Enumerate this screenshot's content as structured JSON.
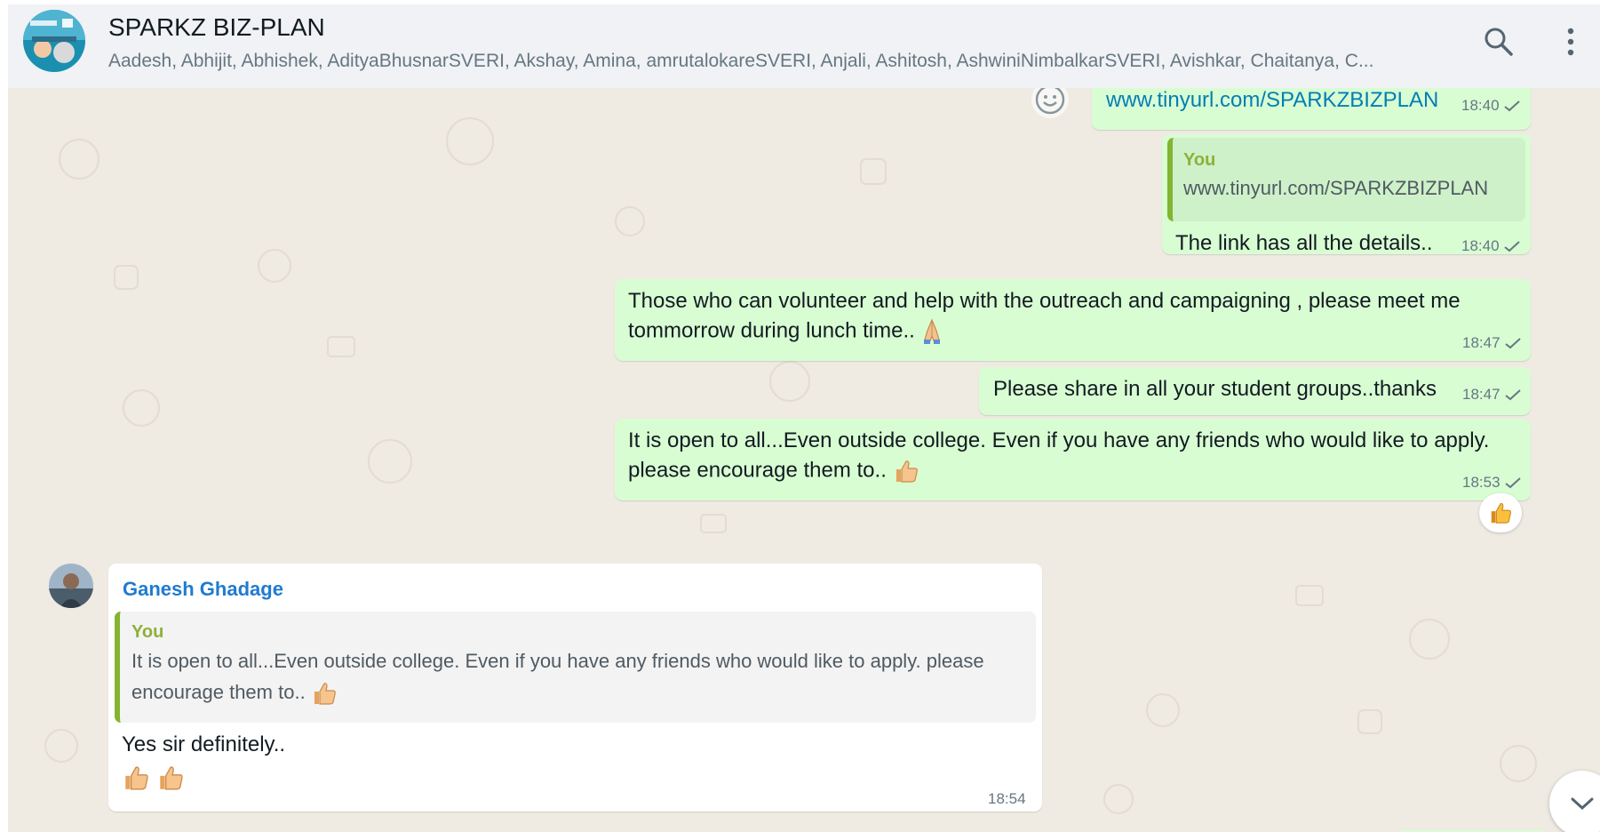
{
  "header": {
    "title": "SPARKZ BIZ-PLAN",
    "members": "Aadesh, Abhijit, Abhishek, AdityaBhusnarSVERI, Akshay, Amina, amrutalokareSVERI, Anjali, Ashitosh, AshwiniNimbalkarSVERI, Avishkar, Chaitanya, C...",
    "icons": [
      "search-icon",
      "more-vertical-icon"
    ]
  },
  "messages": {
    "m1": {
      "text": "www.tinyurl.com/SPARKZBIZPLAN",
      "time": "18:40"
    },
    "m2": {
      "quote_author": "You",
      "quote_text": "www.tinyurl.com/SPARKZBIZPLAN",
      "text": "The link has all the details..",
      "time": "18:40"
    },
    "m3": {
      "line1": "Those who can volunteer and help with the outreach and campaigning , please meet me",
      "line2": "tommorrow during lunch time..",
      "emoji": "folded-hands",
      "time": "18:47"
    },
    "m4": {
      "text": "Please share in all your student groups..thanks",
      "time": "18:47"
    },
    "m5": {
      "line1": "It is open to all...Even outside college. Even if you have any friends who would like to apply.",
      "line2": "please encourage them to..",
      "emoji": "thumbs-up",
      "time": "18:53",
      "reaction": "thumbs-up"
    },
    "m6": {
      "sender": "Ganesh Ghadage",
      "quote_author": "You",
      "quote_line1": "It is open to all...Even outside college. Even if you have any friends who would like to apply. please",
      "quote_line2": "encourage them to..",
      "text": "Yes sir definitely..",
      "emojis": [
        "thumbs-up",
        "thumbs-up"
      ],
      "time": "18:54"
    }
  },
  "colors": {
    "outgoing_bubble": "#d9fdd3",
    "incoming_bubble": "#ffffff",
    "chat_background": "#efeae2",
    "link": "#027eb5",
    "sender_name": "#1f7bcf",
    "quote_accent": "#84b431"
  }
}
